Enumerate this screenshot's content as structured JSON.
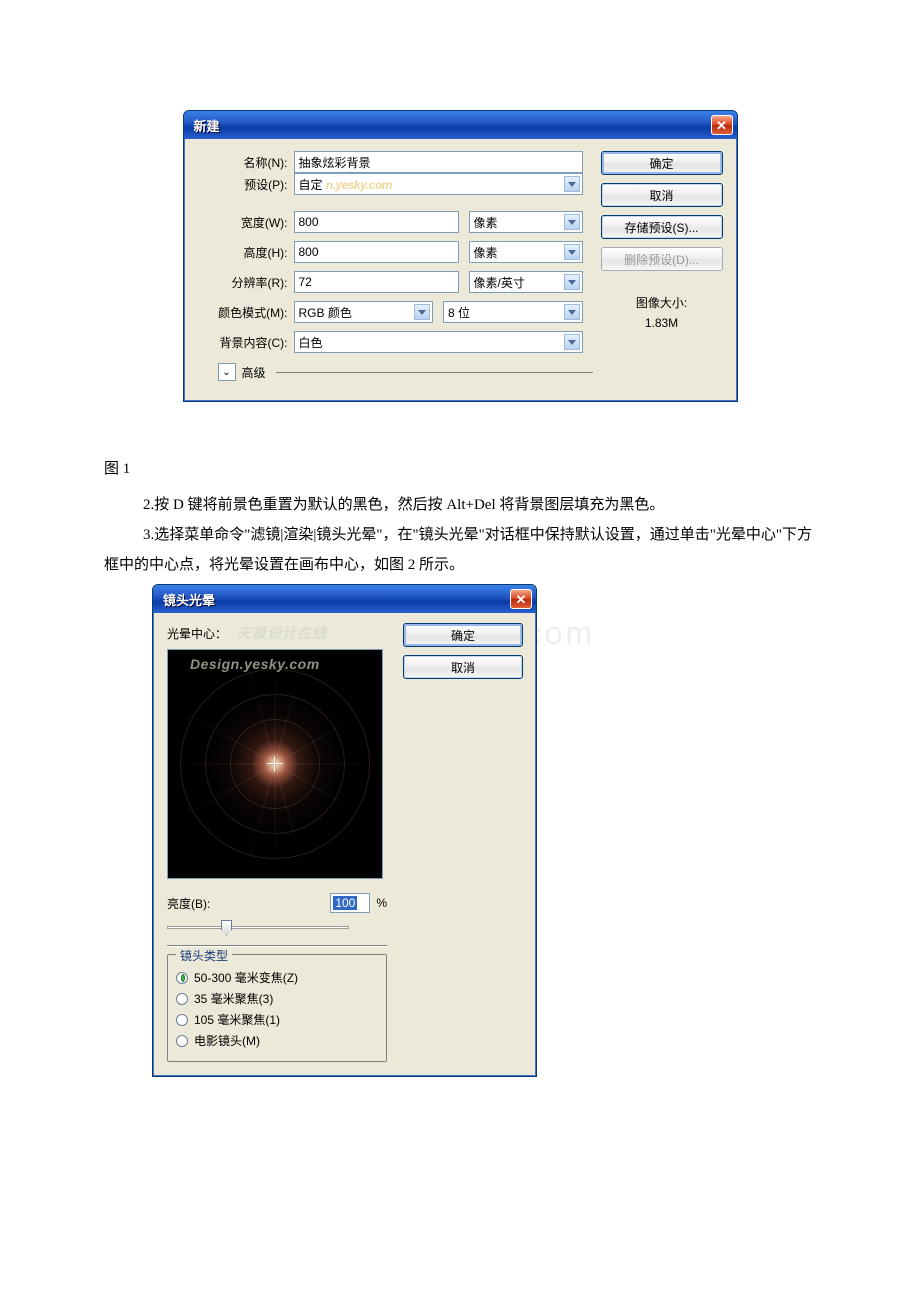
{
  "figure1_label": "图 1",
  "watermark_bdocx": "www.bdocx.com",
  "body_paragraphs": {
    "p2": "2.按 D 键将前景色重置为默认的黑色，然后按 Alt+Del 将背景图层填充为黑色。",
    "p3": "3.选择菜单命令\"滤镜|渲染|镜头光晕\"，在\"镜头光晕\"对话框中保持默认设置，通过单击\"光晕中心\"下方框中的中心点，将光晕设置在画布中心，如图 2 所示。"
  },
  "dialog_new": {
    "title": "新建",
    "labels": {
      "name": "名称(N):",
      "preset": "预设(P):",
      "width": "宽度(W):",
      "height": "高度(H):",
      "resolution": "分辨率(R):",
      "color_mode": "颜色模式(M):",
      "bg_content": "背景内容(C):",
      "advanced": "高级"
    },
    "values": {
      "name": "抽象炫彩背景",
      "preset": "自定",
      "preset_watermark": "n.yesky.com",
      "width": "800",
      "height": "800",
      "resolution": "72",
      "color_mode": "RGB 颜色",
      "bit_depth": "8 位",
      "bg_content": "白色"
    },
    "units": {
      "width": "像素",
      "height": "像素",
      "resolution": "像素/英寸"
    },
    "side": {
      "ok": "确定",
      "cancel": "取消",
      "save_preset": "存储预设(S)...",
      "delete_preset": "删除预设(D)...",
      "image_size_label": "图像大小:",
      "image_size_value": "1.83M"
    }
  },
  "dialog_flare": {
    "title": "镜头光晕",
    "center_label": "光晕中心：",
    "center_watermark": "天极设计在线",
    "preview_watermark": "Design.yesky.com",
    "brightness_label": "亮度(B):",
    "brightness_value": "100",
    "brightness_unit": "%",
    "lens_type_legend": "镜头类型",
    "options": {
      "o1": "50-300 毫米变焦(Z)",
      "o2": "35 毫米聚焦(3)",
      "o3": "105 毫米聚焦(1)",
      "o4": "电影镜头(M)"
    },
    "selected_option": "o1",
    "side": {
      "ok": "确定",
      "cancel": "取消"
    }
  }
}
